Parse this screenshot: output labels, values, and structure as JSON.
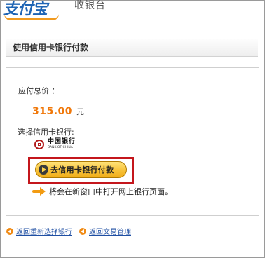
{
  "header": {
    "logo_text": "支付宝",
    "title": "收银台"
  },
  "section_title": "使用信用卡银行付款",
  "payment": {
    "amount_label": "应付总价 ：",
    "amount_value": "315.00",
    "currency": "元",
    "choose_bank_label": "选择信用卡银行:",
    "bank": {
      "name_cn": "中国银行",
      "name_en": "BANK OF CHINA"
    },
    "pay_button_label": "去信用卡银行付款",
    "note": "将会在新窗口中打开网上银行页面。"
  },
  "footer": {
    "links": [
      {
        "label": "返回重新选择银行",
        "icon": "back-arrow-icon"
      },
      {
        "label": "返回交易管理",
        "icon": "back-arrow-icon"
      }
    ]
  },
  "colors": {
    "highlight_border": "#c4161c",
    "amount": "#f0780a",
    "link": "#1f4fa3",
    "logo": "#1e64b4",
    "button": "#f7c23a"
  }
}
